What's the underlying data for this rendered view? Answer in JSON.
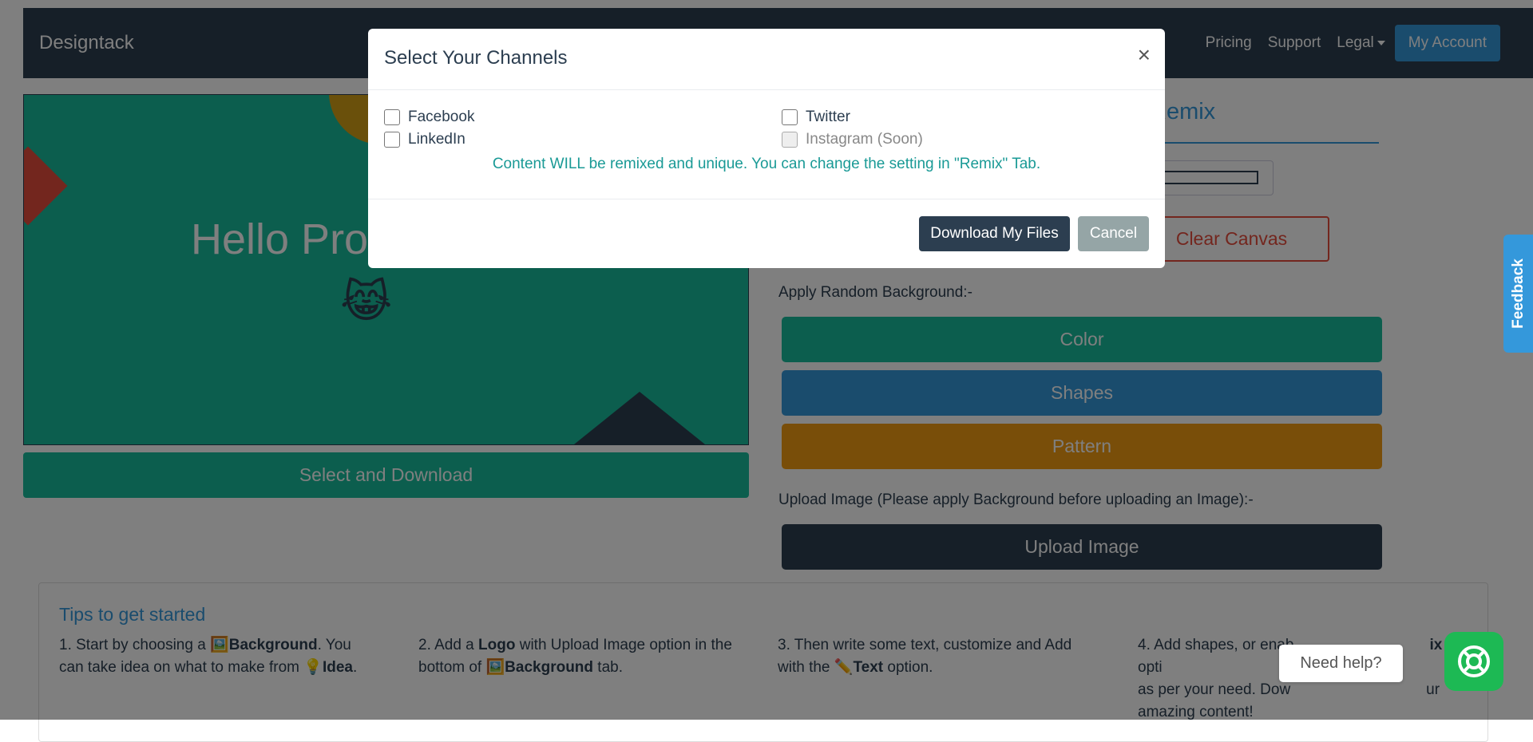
{
  "navbar": {
    "brand": "Designtack",
    "links": [
      "Pricing",
      "Support",
      "Legal"
    ],
    "account": "My Account"
  },
  "canvas": {
    "text": "Hello Prod",
    "emoji": "😹",
    "select_download": "Select and Download"
  },
  "panel": {
    "tab_remix": "Remix",
    "clear_canvas": "Clear Canvas",
    "random_bg_label": "Apply Random Background:-",
    "color_btn": "Color",
    "shapes_btn": "Shapes",
    "pattern_btn": "Pattern",
    "upload_label": "Upload Image (Please apply Background before uploading an Image):-",
    "upload_btn": "Upload Image",
    "colors": {
      "color": "#18bc9c",
      "shapes": "#3498db",
      "pattern": "#f39c12",
      "upload": "#2c3e50"
    }
  },
  "tips": {
    "title": "Tips to get started",
    "step1": {
      "a": "1. Start by choosing a ",
      "b": "Background",
      "c": ". You can take idea on what to make from ",
      "d": "Idea",
      "e": "."
    },
    "step2": {
      "a": "2. Add a ",
      "b": "Logo",
      "c": " with Upload Image option in the bottom of ",
      "d": "Background",
      "e": " tab."
    },
    "step3": {
      "a": "3. Then write some text, customize and Add with the ",
      "b": "Text",
      "c": " option."
    },
    "step4": {
      "a": "4. Add shapes, or enab",
      "b": "ix",
      "c": " opti",
      "d": "as per your need. Dow",
      "e": "ur",
      "f": "amazing content!"
    }
  },
  "modal": {
    "title": "Select Your Channels",
    "close": "×",
    "channels": [
      {
        "label": "Facebook",
        "disabled": false
      },
      {
        "label": "Twitter",
        "disabled": false
      },
      {
        "label": "LinkedIn",
        "disabled": false
      },
      {
        "label": "Instagram (Soon)",
        "disabled": true
      }
    ],
    "note": "Content WILL be remixed and unique. You can change the setting in \"Remix\" Tab.",
    "download_btn": "Download My Files",
    "cancel_btn": "Cancel"
  },
  "widgets": {
    "feedback": "Feedback",
    "help": "Need help?"
  }
}
